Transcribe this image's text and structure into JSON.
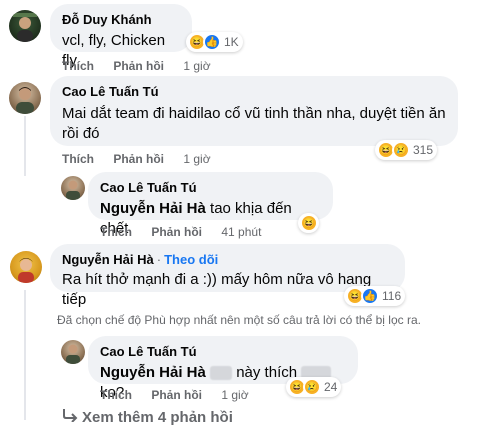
{
  "comments": [
    {
      "author": "Đỗ Duy Khánh",
      "text": "vcl, fly, Chicken fly",
      "actions": {
        "like": "Thích",
        "reply": "Phản hồi",
        "time": "1 giờ"
      },
      "reactions": {
        "icons": [
          "haha-icon",
          "like-icon"
        ],
        "count": "1K"
      }
    },
    {
      "author": "Cao Lê Tuấn Tú",
      "text": "Mai dắt team đi haidilao cổ vũ tinh thần nha, duyệt tiền ăn rồi đó",
      "actions": {
        "like": "Thích",
        "reply": "Phản hồi",
        "time": "1 giờ"
      },
      "reactions": {
        "icons": [
          "haha-icon",
          "sad-icon"
        ],
        "count": "315"
      }
    },
    {
      "author": "Cao Lê Tuấn Tú",
      "mention": "Nguyễn Hải Hà",
      "text": "tao khịa đến chết",
      "actions": {
        "like": "Thích",
        "reply": "Phản hồi",
        "time": "41 phút"
      },
      "reactions": {
        "icons": [
          "haha-icon"
        ],
        "count": ""
      }
    },
    {
      "author": "Nguyễn Hải Hà",
      "follow": "Theo dõi",
      "text": "Ra hít thở mạnh đi a :)) mấy hôm nữa vô hang tiếp",
      "actions": {
        "like": "Thích",
        "reply": "Phản hồi",
        "time": "1 giờ"
      },
      "reactions": {
        "icons": [
          "haha-icon",
          "like-icon"
        ],
        "count": "116"
      }
    },
    {
      "author": "Cao Lê Tuấn Tú",
      "mention": "Nguyễn Hải Hà",
      "text_a": "này thích",
      "text_b": "ko?",
      "actions": {
        "like": "Thích",
        "reply": "Phản hồi",
        "time": "1 giờ"
      },
      "reactions": {
        "icons": [
          "haha-icon",
          "sad-icon"
        ],
        "count": "24"
      }
    }
  ],
  "filter_notice": "Đã chọn chế độ Phù hợp nhất nên một số câu trả lời có thể bị lọc ra.",
  "see_more": "Xem thêm 4 phản hồi",
  "colors": {
    "bubble": "#f0f2f5",
    "text": "#050505",
    "secondary": "#65676b",
    "accent": "#1877f2"
  }
}
